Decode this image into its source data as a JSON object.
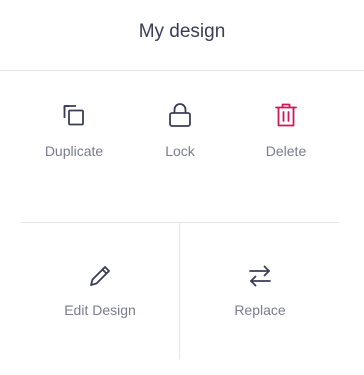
{
  "header": {
    "title": "My design"
  },
  "actions": {
    "duplicate": {
      "label": "Duplicate",
      "icon": "copy-icon"
    },
    "lock": {
      "label": "Lock",
      "icon": "lock-icon"
    },
    "delete": {
      "label": "Delete",
      "icon": "trash-icon"
    },
    "edit_design": {
      "label": "Edit Design",
      "icon": "pencil-icon"
    },
    "replace": {
      "label": "Replace",
      "icon": "swap-arrows-icon"
    }
  },
  "colors": {
    "text": "#3b3c57",
    "muted": "#7a7b8f",
    "danger": "#d0175a",
    "divider": "#e6e6ea"
  }
}
